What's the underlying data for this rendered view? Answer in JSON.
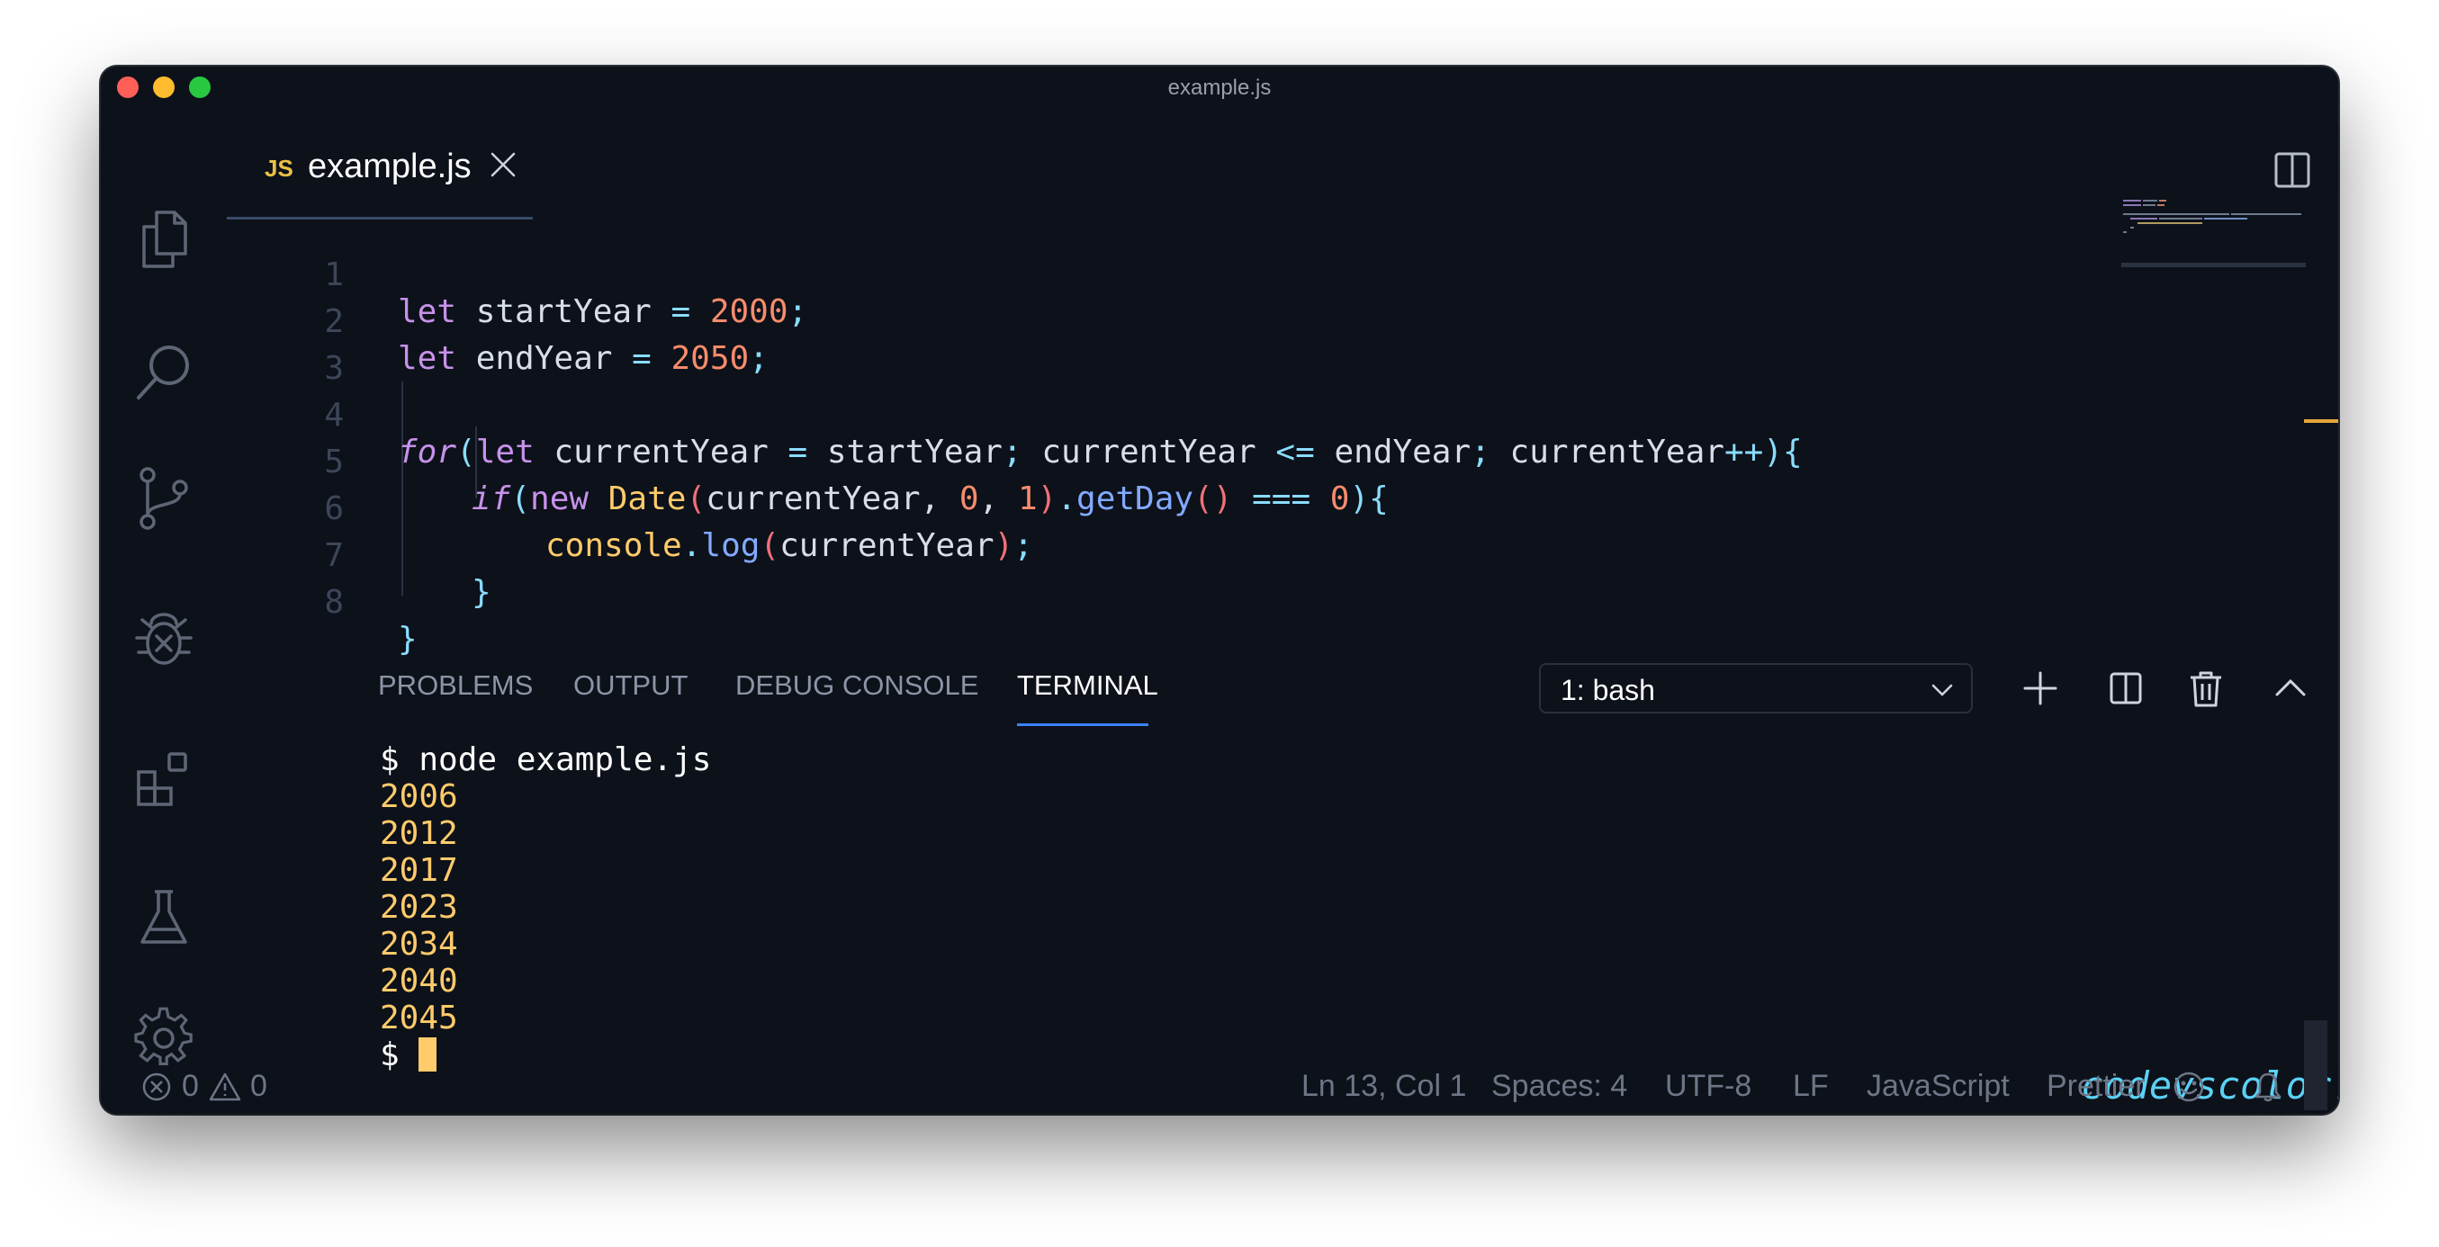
{
  "window": {
    "title": "example.js"
  },
  "activity_bar": {
    "items": [
      "explorer-icon",
      "search-icon",
      "source-control-icon",
      "debug-icon",
      "extensions-icon",
      "testing-icon",
      "gear-icon"
    ]
  },
  "tab": {
    "lang_badge": "JS",
    "label": "example.js"
  },
  "editor": {
    "lines": [
      {
        "number": "1",
        "tokens": [
          [
            "kw",
            "let"
          ],
          [
            "",
            "startYear"
          ],
          [
            "op",
            "="
          ],
          [
            "num",
            "2000"
          ],
          [
            "op",
            ";"
          ]
        ]
      },
      {
        "number": "2",
        "tokens": [
          [
            "kw",
            "let"
          ],
          [
            "",
            "endYear"
          ],
          [
            "op",
            "="
          ],
          [
            "num",
            "2050"
          ],
          [
            "op",
            ";"
          ]
        ]
      },
      {
        "number": "3",
        "tokens": []
      },
      {
        "number": "4",
        "tokens": []
      },
      {
        "number": "5",
        "tokens": []
      },
      {
        "number": "6",
        "tokens": []
      },
      {
        "number": "7",
        "tokens": []
      },
      {
        "number": "8",
        "tokens": []
      }
    ],
    "code": {
      "l1_kw": "let",
      "l1_var": " startYear ",
      "l1_op": "=",
      "l1_num": " 2000",
      "l1_end": ";",
      "l2_kw": "let",
      "l2_var": " endYear ",
      "l2_op": "=",
      "l2_num": " 2050",
      "l2_end": ";",
      "l4_for": "for",
      "l4_p1": "(",
      "l4_let": "let",
      "l4_a": " currentYear ",
      "l4_eq": "=",
      "l4_b": " startYear",
      "l4_s1": ";",
      "l4_c": " currentYear ",
      "l4_le": "<=",
      "l4_d": " endYear",
      "l4_s2": ";",
      "l4_e": " currentYear",
      "l4_pp": "++",
      "l4_p2": ")",
      "l4_br": "{",
      "l5_if": "if",
      "l5_p1": "(",
      "l5_new": "new",
      "l5_date": " Date",
      "l5_p2": "(",
      "l5_a": "currentYear, ",
      "l5_n0": "0",
      "l5_c": ", ",
      "l5_n1": "1",
      "l5_p3": ")",
      "l5_dot": ".",
      "l5_fn": "getDay",
      "l5_p4": "()",
      "l5_eq": " === ",
      "l5_n2": "0",
      "l5_p5": ")",
      "l5_br": "{",
      "l6_obj": "console",
      "l6_dot": ".",
      "l6_fn": "log",
      "l6_p1": "(",
      "l6_a": "currentYear",
      "l6_p2": ")",
      "l6_end": ";",
      "l7_br": "}",
      "l8_br": "}"
    }
  },
  "panel": {
    "tabs": [
      "PROBLEMS",
      "OUTPUT",
      "DEBUG CONSOLE",
      "TERMINAL"
    ],
    "active_tab": "TERMINAL",
    "terminal_select": "1: bash"
  },
  "terminal": {
    "command_prompt": "$ node example.js",
    "outputs": [
      "2006",
      "2012",
      "2017",
      "2023",
      "2034",
      "2040",
      "2045"
    ],
    "prompt": "$ "
  },
  "watermark": "codevscolor.com",
  "statusbar": {
    "errors": "0",
    "warnings": "0",
    "position": "Ln 13, Col 1",
    "spaces": "Spaces: 4",
    "encoding": "UTF-8",
    "eol": "LF",
    "language": "JavaScript",
    "formatter": "Prettier"
  },
  "colors": {
    "accent": "#3b82f6",
    "background": "#0d111a",
    "cursor": "#ffcb6b"
  }
}
